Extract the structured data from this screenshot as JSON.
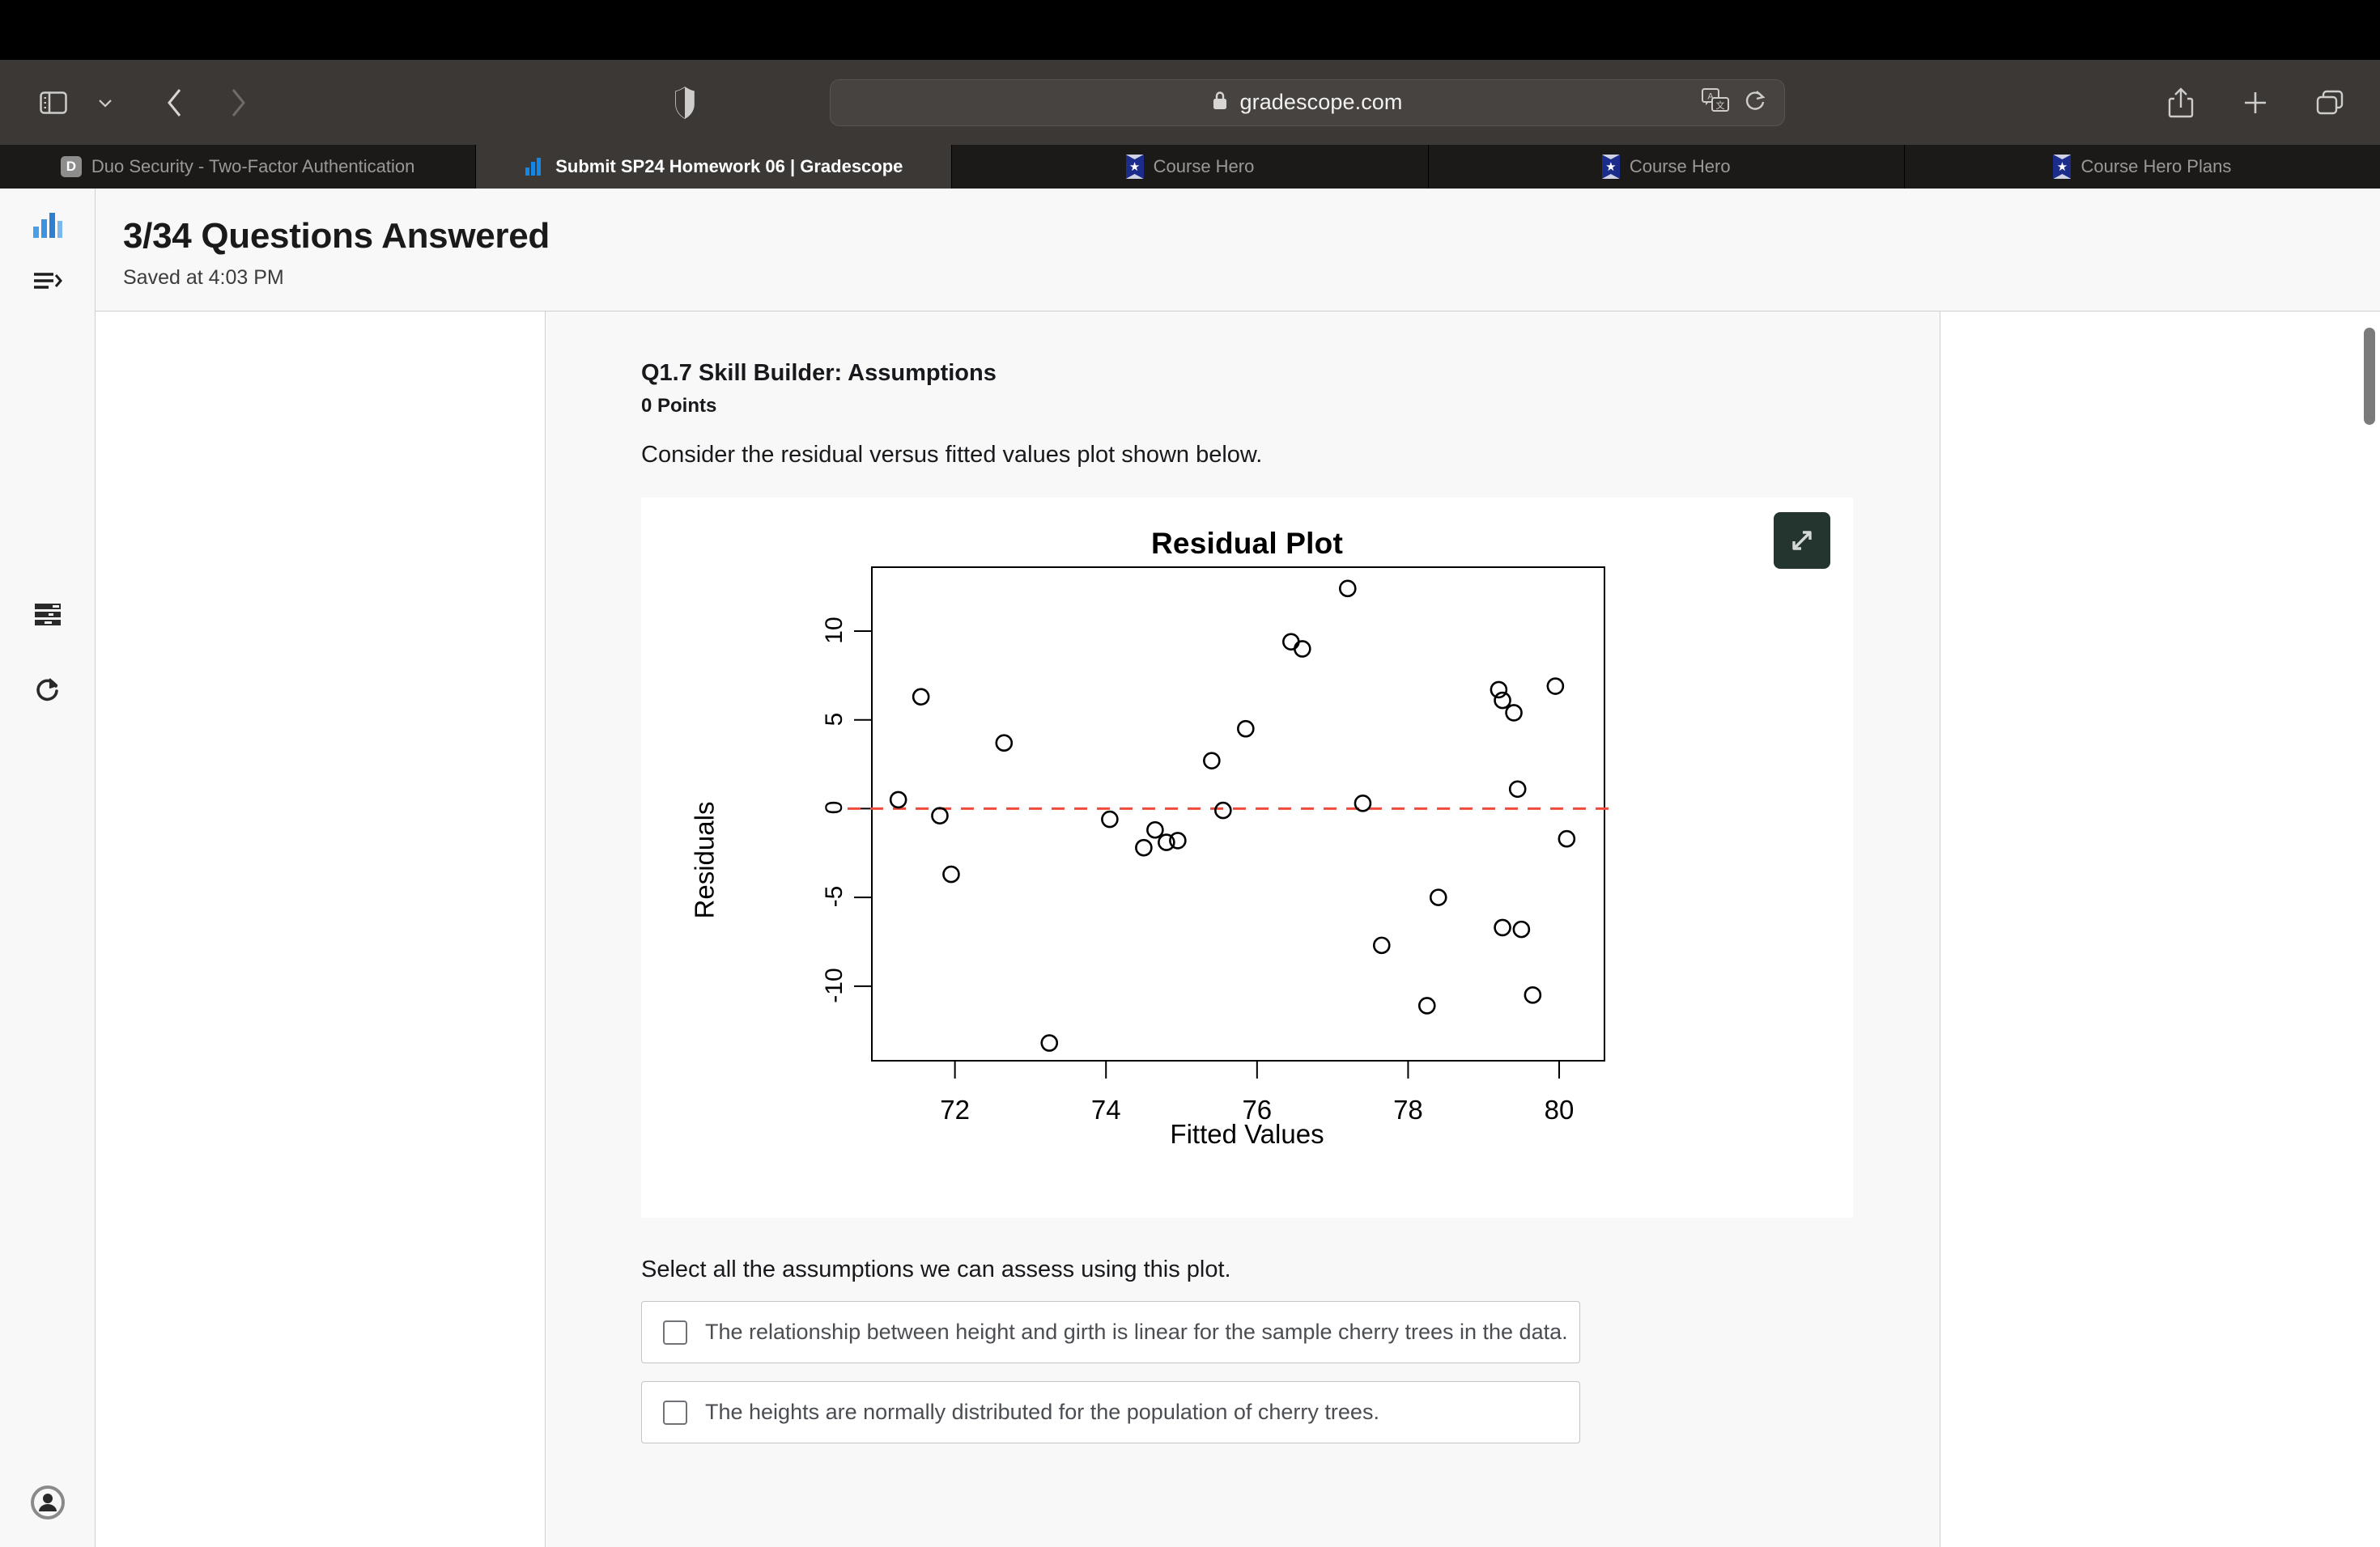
{
  "browser": {
    "address": {
      "url": "gradescope.com",
      "lock_icon": "lock-icon",
      "translate_icon": "translate-icon",
      "reload_icon": "reload-icon"
    },
    "controls": {
      "sidebar_icon": "sidebar-toggle-icon",
      "chevron_icon": "chevron-down-icon",
      "back_icon": "back-arrow-icon",
      "forward_icon": "forward-arrow-icon",
      "shield_icon": "privacy-shield-icon",
      "share_icon": "share-icon",
      "new_tab_icon": "plus-icon",
      "tab_overview_icon": "tab-overview-icon"
    },
    "tabs": [
      {
        "label": "Duo Security - Two-Factor Authentication",
        "favicon": "duo-icon",
        "active": false
      },
      {
        "label": "Submit SP24 Homework 06 | Gradescope",
        "favicon": "gradescope-icon",
        "active": true
      },
      {
        "label": "Course Hero",
        "favicon": "course-hero-icon",
        "active": false
      },
      {
        "label": "Course Hero",
        "favicon": "course-hero-icon",
        "active": false
      },
      {
        "label": "Course Hero Plans",
        "favicon": "course-hero-icon",
        "active": false
      }
    ]
  },
  "sidebar": {
    "logo_icon": "gradescope-bars-icon",
    "items": [
      {
        "icon": "menu-expand-icon",
        "name": "menu-expand"
      },
      {
        "icon": "outline-list-icon",
        "name": "question-outline"
      },
      {
        "icon": "refresh-icon",
        "name": "refresh"
      }
    ],
    "account_icon": "account-avatar-icon"
  },
  "header": {
    "title": "3/34 Questions Answered",
    "saved_status": "Saved at 4:03 PM"
  },
  "question": {
    "title": "Q1.7 Skill Builder: Assumptions",
    "points": "0 Points",
    "prompt": "Consider the residual versus fitted values plot shown below.",
    "select_prompt": "Select all the assumptions we can assess using this plot.",
    "expand_icon": "expand-arrows-icon",
    "options": [
      {
        "label": "The relationship between height and girth is linear for the sample cherry trees in the data.",
        "checked": false
      },
      {
        "label": "The heights are normally distributed for the population of cherry trees.",
        "checked": false
      }
    ]
  },
  "chart_data": {
    "type": "scatter",
    "title": "Residual Plot",
    "xlabel": "Fitted Values",
    "ylabel": "Residuals",
    "xlim": [
      70.9,
      80.6
    ],
    "ylim": [
      -14.2,
      13.6
    ],
    "xticks": [
      72,
      74,
      76,
      78,
      80
    ],
    "yticks": [
      10,
      5,
      0,
      -5,
      -10
    ],
    "grid": false,
    "reference_line": {
      "y": 0,
      "style": "dashed",
      "color": "#f04a3c"
    },
    "marker": {
      "shape": "open-circle",
      "color": "#000000"
    },
    "points": [
      {
        "x": 71.25,
        "y": 0.5
      },
      {
        "x": 71.55,
        "y": 6.3
      },
      {
        "x": 71.8,
        "y": -0.4
      },
      {
        "x": 71.95,
        "y": -3.7
      },
      {
        "x": 72.65,
        "y": 3.7
      },
      {
        "x": 73.25,
        "y": -13.2
      },
      {
        "x": 74.05,
        "y": -0.6
      },
      {
        "x": 74.5,
        "y": -2.2
      },
      {
        "x": 74.65,
        "y": -1.2
      },
      {
        "x": 74.8,
        "y": -1.9
      },
      {
        "x": 74.95,
        "y": -1.8
      },
      {
        "x": 75.4,
        "y": 2.7
      },
      {
        "x": 75.55,
        "y": -0.1
      },
      {
        "x": 75.85,
        "y": 4.5
      },
      {
        "x": 76.45,
        "y": 9.4
      },
      {
        "x": 76.6,
        "y": 9.0
      },
      {
        "x": 77.2,
        "y": 12.4
      },
      {
        "x": 77.4,
        "y": 0.3
      },
      {
        "x": 77.65,
        "y": -7.7
      },
      {
        "x": 78.25,
        "y": -11.1
      },
      {
        "x": 78.4,
        "y": -5.0
      },
      {
        "x": 79.2,
        "y": 6.7
      },
      {
        "x": 79.25,
        "y": 6.1
      },
      {
        "x": 79.25,
        "y": -6.7
      },
      {
        "x": 79.4,
        "y": 5.4
      },
      {
        "x": 79.45,
        "y": 1.1
      },
      {
        "x": 79.5,
        "y": -6.8
      },
      {
        "x": 79.65,
        "y": -10.5
      },
      {
        "x": 79.95,
        "y": 6.9
      },
      {
        "x": 80.1,
        "y": -1.7
      }
    ]
  }
}
